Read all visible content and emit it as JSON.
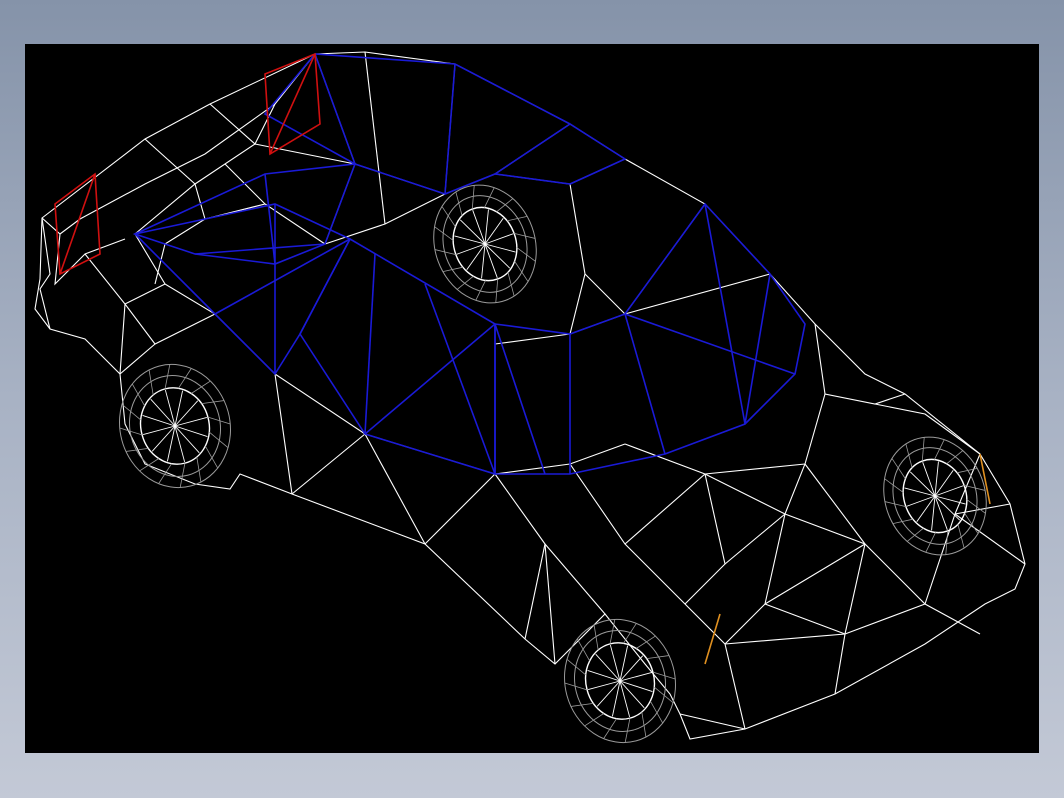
{
  "viewport": {
    "background": "#000000",
    "model": "car-wireframe",
    "colors": {
      "mesh": "#ffffff",
      "glass": "#1a1ad6",
      "accent_red": "#d01010",
      "accent_orange": "#e09020",
      "wheel": "#9a9a9a"
    }
  }
}
